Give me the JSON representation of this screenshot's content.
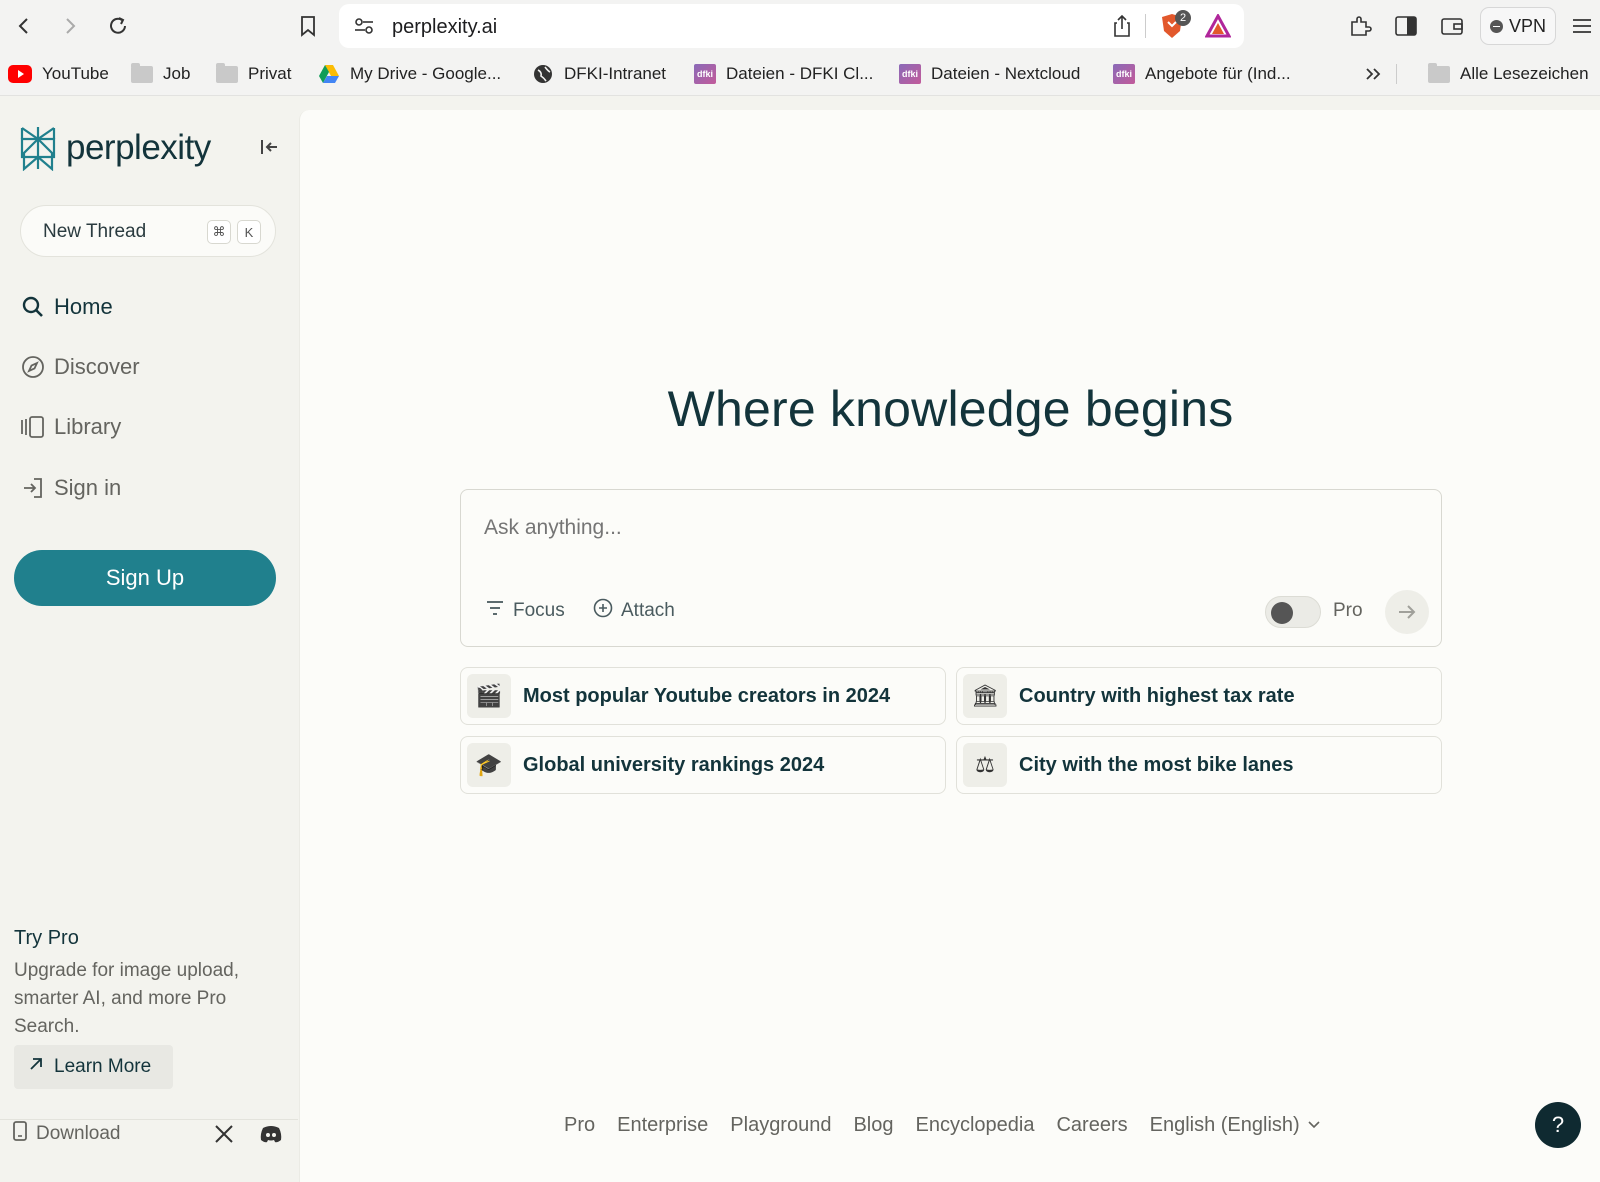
{
  "browser": {
    "url": "perplexity.ai",
    "brave_badge": "2",
    "vpn_label": "VPN",
    "bookmarks": [
      {
        "label": "YouTube",
        "icon": "youtube-icon"
      },
      {
        "label": "Job",
        "icon": "folder-icon"
      },
      {
        "label": "Privat",
        "icon": "folder-icon"
      },
      {
        "label": "My Drive - Google...",
        "icon": "google-drive-icon"
      },
      {
        "label": "DFKI-Intranet",
        "icon": "globe-icon"
      },
      {
        "label": "Dateien - DFKI Cl...",
        "icon": "dfki-icon"
      },
      {
        "label": "Dateien - Nextcloud",
        "icon": "dfki-icon"
      },
      {
        "label": "Angebote für (Ind...",
        "icon": "dfki-icon"
      }
    ],
    "all_bookmarks": "Alle Lesezeichen",
    "dfki_text": "dfki"
  },
  "sidebar": {
    "logo_text": "perplexity",
    "new_thread": "New Thread",
    "shortcut_cmd": "⌘",
    "shortcut_key": "K",
    "nav": [
      {
        "label": "Home",
        "icon": "search-icon"
      },
      {
        "label": "Discover",
        "icon": "compass-icon"
      },
      {
        "label": "Library",
        "icon": "library-icon"
      },
      {
        "label": "Sign in",
        "icon": "sign-in-icon"
      }
    ],
    "signup": "Sign Up",
    "try_pro_title": "Try Pro",
    "try_pro_desc": "Upgrade for image upload, smarter AI, and more Pro Search.",
    "learn_more": "Learn More",
    "download": "Download"
  },
  "main": {
    "headline": "Where knowledge begins",
    "ask_placeholder": "Ask anything...",
    "focus": "Focus",
    "attach": "Attach",
    "pro_label": "Pro",
    "suggestions": [
      {
        "emoji": "🎬",
        "text": "Most popular Youtube creators in 2024"
      },
      {
        "emoji": "🏛",
        "text": "Country with highest tax rate"
      },
      {
        "emoji": "🎓",
        "text": "Global university rankings 2024"
      },
      {
        "emoji": "⚖",
        "text": "City with the most bike lanes"
      }
    ],
    "footer_links": [
      "Pro",
      "Enterprise",
      "Playground",
      "Blog",
      "Encyclopedia",
      "Careers",
      "English (English)"
    ],
    "help": "?"
  },
  "colors": {
    "accent": "#20808d",
    "text_dark": "#13343b",
    "sidebar_bg": "#f3f3ee",
    "main_bg": "#fcfcf9"
  }
}
